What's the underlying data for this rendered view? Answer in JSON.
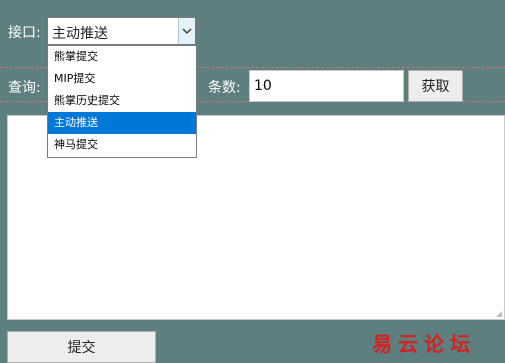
{
  "form": {
    "interface_label": "接口:",
    "query_label": "查询:",
    "count_label": "条数:",
    "fetch_label": "获取",
    "submit_label": "提交",
    "count_value": "10",
    "query_value": "",
    "result_text": ""
  },
  "select": {
    "selected_value": "主动推送",
    "options": [
      "熊掌提交",
      "MIP提交",
      "熊掌历史提交",
      "主动推送",
      "神马提交"
    ],
    "highlighted_index": 3,
    "arrow_icon": "chevron-down-icon"
  },
  "watermark": {
    "text": "易云论坛"
  },
  "colors": {
    "background": "#5e7f7f",
    "selection": "#0078d7",
    "watermark": "#d32222",
    "dashed_border": "#d07070"
  }
}
